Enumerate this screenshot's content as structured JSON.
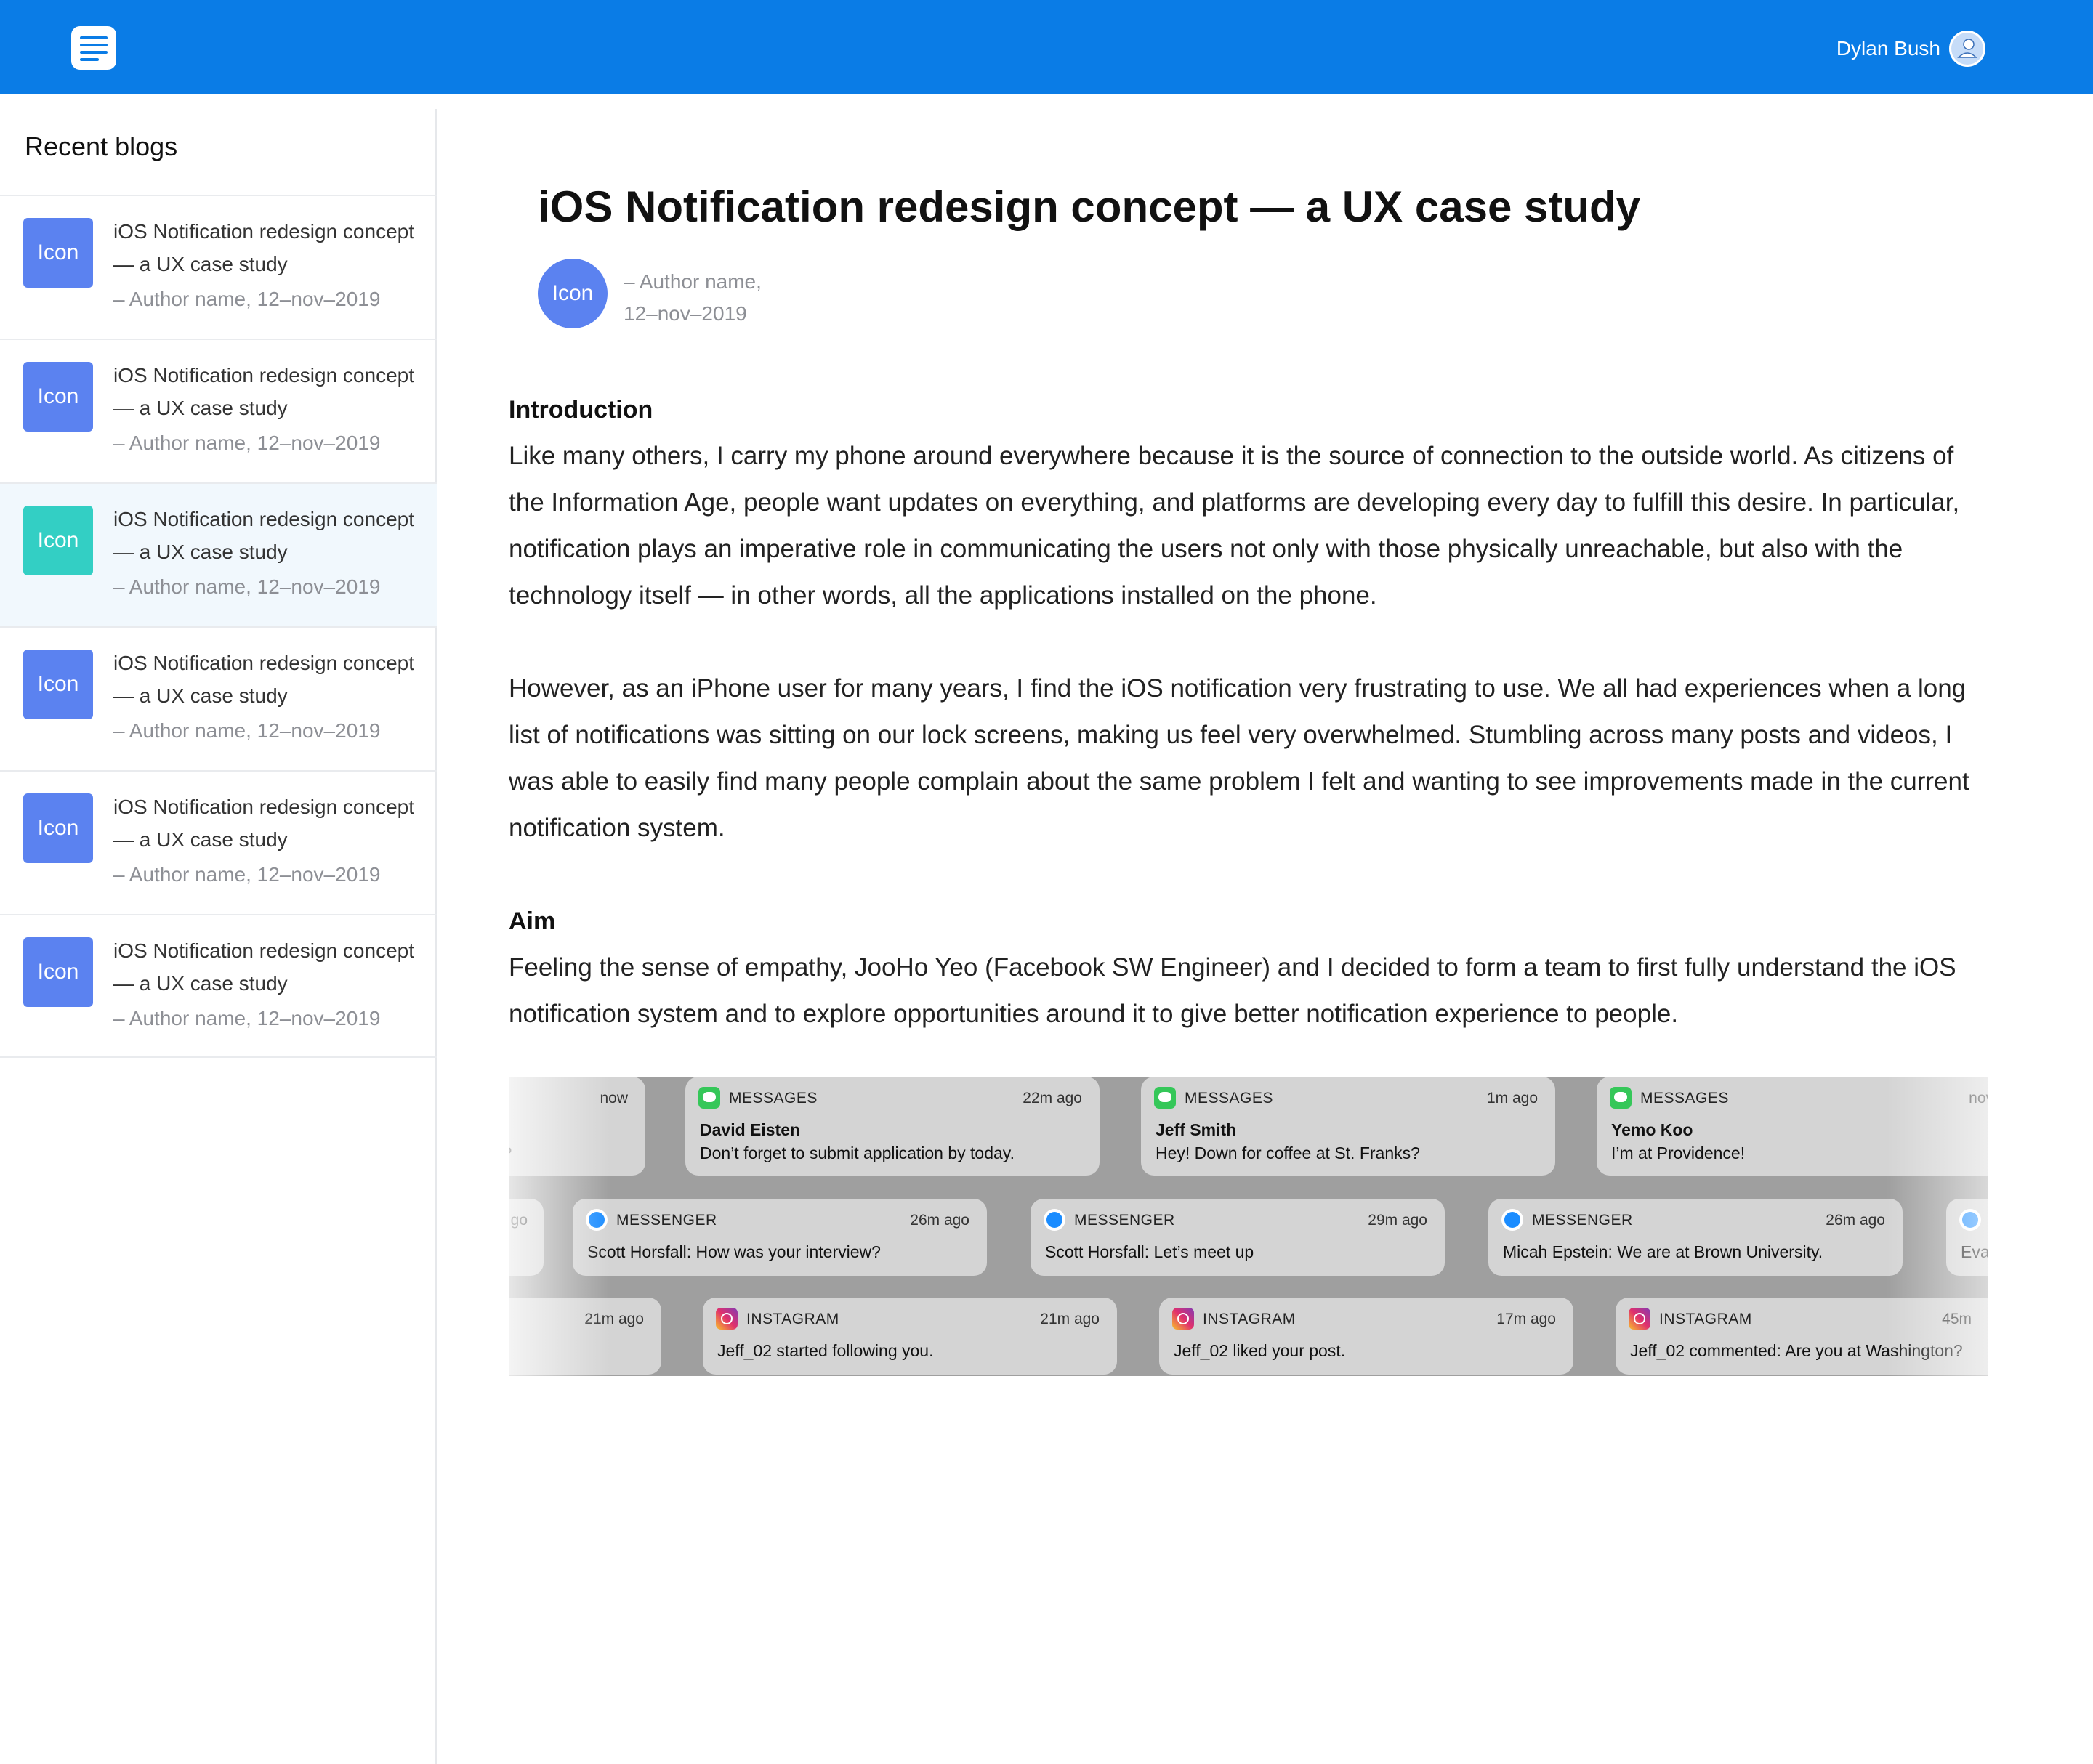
{
  "header": {
    "user_name": "Dylan Bush"
  },
  "sidebar": {
    "title": "Recent blogs",
    "items": [
      {
        "icon_label": "Icon",
        "title": "iOS Notification redesign concept — a UX case study",
        "meta": "– Author name, 12–nov–2019"
      },
      {
        "icon_label": "Icon",
        "title": "iOS Notification redesign concept — a UX case study",
        "meta": "– Author name, 12–nov–2019"
      },
      {
        "icon_label": "Icon",
        "title": "iOS Notification redesign concept — a UX case study",
        "meta": "– Author name, 12–nov–2019"
      },
      {
        "icon_label": "Icon",
        "title": "iOS Notification redesign concept — a UX case study",
        "meta": "– Author name, 12–nov–2019"
      },
      {
        "icon_label": "Icon",
        "title": "iOS Notification redesign concept — a UX case study",
        "meta": "– Author name, 12–nov–2019"
      },
      {
        "icon_label": "Icon",
        "title": "iOS Notification redesign concept — a UX case study",
        "meta": "– Author name, 12–nov–2019"
      }
    ],
    "active_index": 2
  },
  "article": {
    "title": "iOS Notification redesign concept — a UX case study",
    "author_icon_label": "Icon",
    "author_name": "– Author name,",
    "date": "12–nov–2019",
    "intro_heading": "Introduction",
    "intro_p1": "Like many others, I carry my phone around everywhere because it is the source of connection to the outside world. As citizens of the Information Age, people want updates on everything, and platforms are developing every day to fulfill this desire. In particular, notification plays an imperative role in communicating the users not only with those physically unreachable, but also with the technology itself — in other words, all the applications installed on the phone.",
    "intro_p2": "However, as an iPhone user for many years, I find the iOS notification very frustrating to use. We all had experiences when a long list of notifications was sitting on our lock screens, making us feel very overwhelmed. Stumbling across many posts and videos, I was able to easily find many people complain about the same problem I felt and wanting to see improvements made in the current notification system.",
    "aim_heading": "Aim",
    "aim_p": "Feeling the sense of empathy, JooHo Yeo (Facebook SW Engineer) and I decided to form a team to first fully understand the iOS notification system and to explore opportunities around it to give better notification experience to people."
  },
  "notifications": {
    "row1": [
      {
        "app": "",
        "time": "now",
        "name": "",
        "text": "s?"
      },
      {
        "app": "MESSAGES",
        "time": "22m ago",
        "name": "David Eisten",
        "text": "Don’t forget to submit application by today."
      },
      {
        "app": "MESSAGES",
        "time": "1m ago",
        "name": "Jeff Smith",
        "text": "Hey! Down for coffee at St. Franks?"
      },
      {
        "app": "MESSAGES",
        "time": "nov",
        "name": "Yemo Koo",
        "text": "I’m at Providence!"
      }
    ],
    "row2": [
      {
        "app": "",
        "time": "go",
        "text": ""
      },
      {
        "app": "MESSENGER",
        "time": "26m ago",
        "text": "Scott Horsfall: How was your interview?"
      },
      {
        "app": "MESSENGER",
        "time": "29m ago",
        "text": "Scott Horsfall: Let’s meet up"
      },
      {
        "app": "MESSENGER",
        "time": "26m ago",
        "text": "Micah Epstein: We are at Brown University."
      },
      {
        "app": "",
        "time": "",
        "text": "Eva"
      }
    ],
    "row3": [
      {
        "app": "",
        "time": "21m ago",
        "text": ""
      },
      {
        "app": "INSTAGRAM",
        "time": "21m ago",
        "text": "Jeff_02 started following you."
      },
      {
        "app": "INSTAGRAM",
        "time": "17m ago",
        "text": "Jeff_02 liked your post."
      },
      {
        "app": "INSTAGRAM",
        "time": "45m",
        "text": "Jeff_02 commented: Are you at Washington?"
      }
    ]
  },
  "colors": {
    "header_bg": "#0a7ce6",
    "thumb_blue": "#5b82f0",
    "thumb_teal": "#33cfc4",
    "active_row_bg": "#f1f8fd"
  }
}
